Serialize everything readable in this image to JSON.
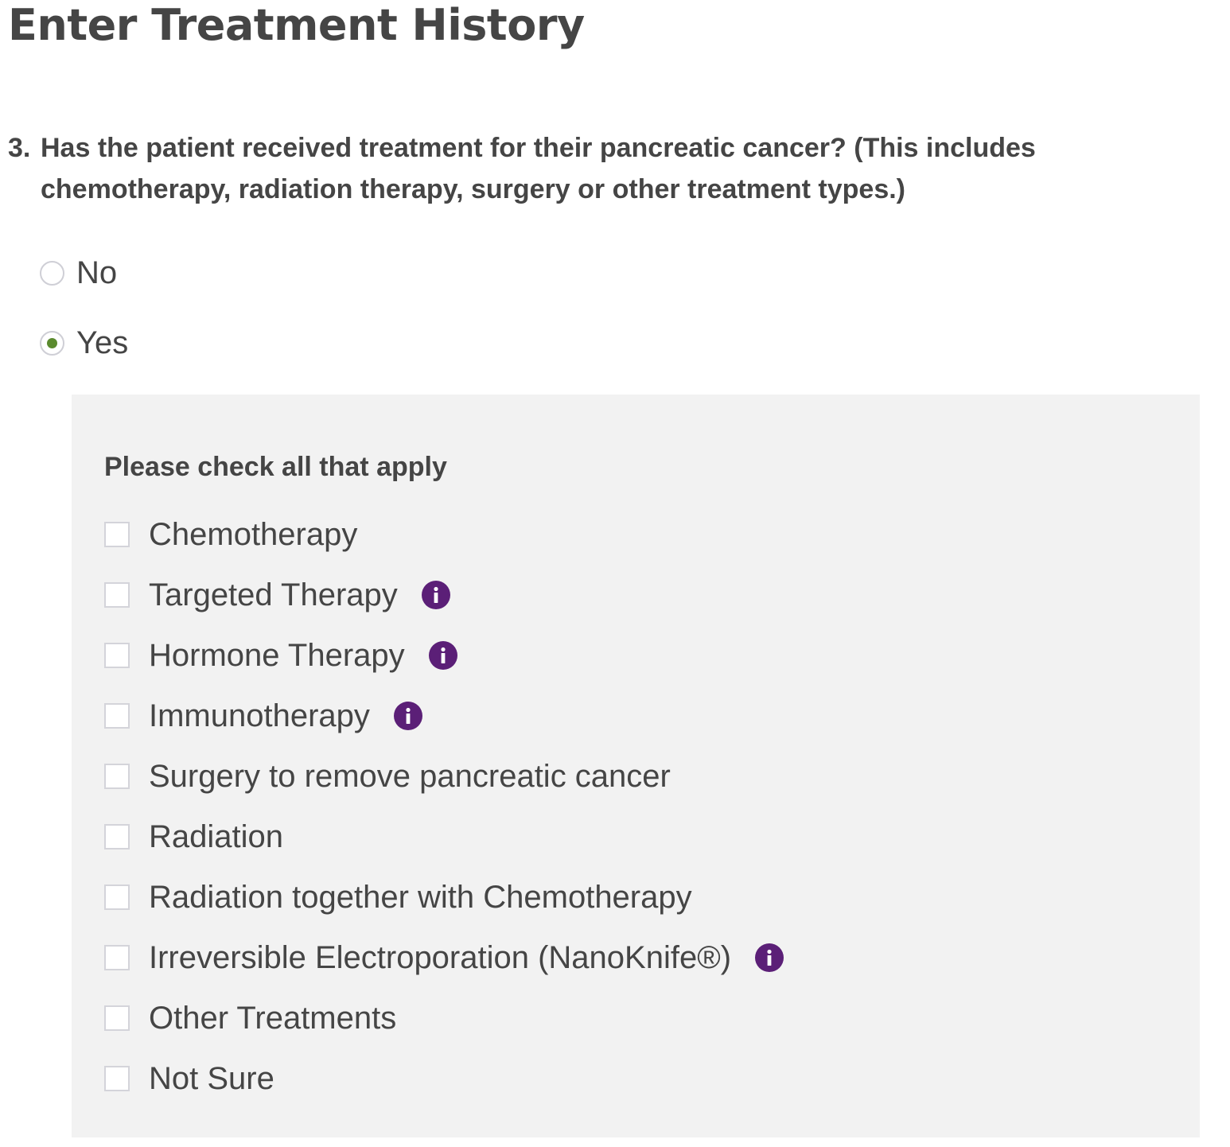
{
  "page": {
    "title": "Enter Treatment History"
  },
  "question": {
    "number": "3.",
    "text": "Has the patient received treatment for their pancreatic cancer? (This includes chemotherapy, radiation therapy, surgery or other treatment types.)",
    "options": [
      {
        "label": "No",
        "selected": false
      },
      {
        "label": "Yes",
        "selected": true
      }
    ]
  },
  "panel": {
    "heading": "Please check all that apply",
    "options": [
      {
        "label": "Chemotherapy",
        "checked": false,
        "info": false
      },
      {
        "label": "Targeted Therapy",
        "checked": false,
        "info": true
      },
      {
        "label": "Hormone Therapy",
        "checked": false,
        "info": true
      },
      {
        "label": "Immunotherapy",
        "checked": false,
        "info": true
      },
      {
        "label": "Surgery to remove pancreatic cancer",
        "checked": false,
        "info": false
      },
      {
        "label": "Radiation",
        "checked": false,
        "info": false
      },
      {
        "label": "Radiation together with Chemotherapy",
        "checked": false,
        "info": false
      },
      {
        "label": "Irreversible Electroporation (NanoKnife®)",
        "checked": false,
        "info": true
      },
      {
        "label": "Other Treatments",
        "checked": false,
        "info": false
      },
      {
        "label": "Not Sure",
        "checked": false,
        "info": false
      }
    ]
  },
  "icons": {
    "info": "info-circle-icon"
  },
  "colors": {
    "text": "#454545",
    "radio_selected": "#5a8a2e",
    "info_icon": "#5b1f77",
    "panel_background": "#f2f2f2"
  }
}
